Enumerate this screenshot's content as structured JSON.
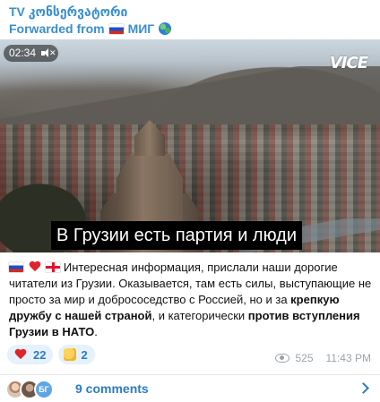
{
  "header": {
    "channel_title": "TV კონსერვატორი",
    "forwarded_prefix": "Forwarded from",
    "forwarded_source": "МИГ"
  },
  "video": {
    "duration": "02:34",
    "watermark": "VICE",
    "subtitle": "В Грузии есть партия и люди"
  },
  "message": {
    "part1": "Интересная информация, прислали наши дорогие читатели из Грузии. Оказывается, там есть силы, выступающие не просто за мир и добрососедство с Россией, но и за ",
    "bold1": "крепкую дружбу с нашей страной",
    "part2": ", и категорически ",
    "bold2": "против вступления Грузии в НАТО",
    "part3": "."
  },
  "reactions": [
    {
      "emoji": "heart",
      "count": "22"
    },
    {
      "emoji": "thumbs-up",
      "count": "2"
    }
  ],
  "meta": {
    "views": "525",
    "time": "11:43 PM"
  },
  "comments": {
    "avatar3_initials": "БГ",
    "label": "9 comments"
  },
  "colors": {
    "accent": "#3a8fd2",
    "link": "#2a7cc7",
    "reaction_bg": "#e6f1fb",
    "meta": "#9aa3ab"
  }
}
